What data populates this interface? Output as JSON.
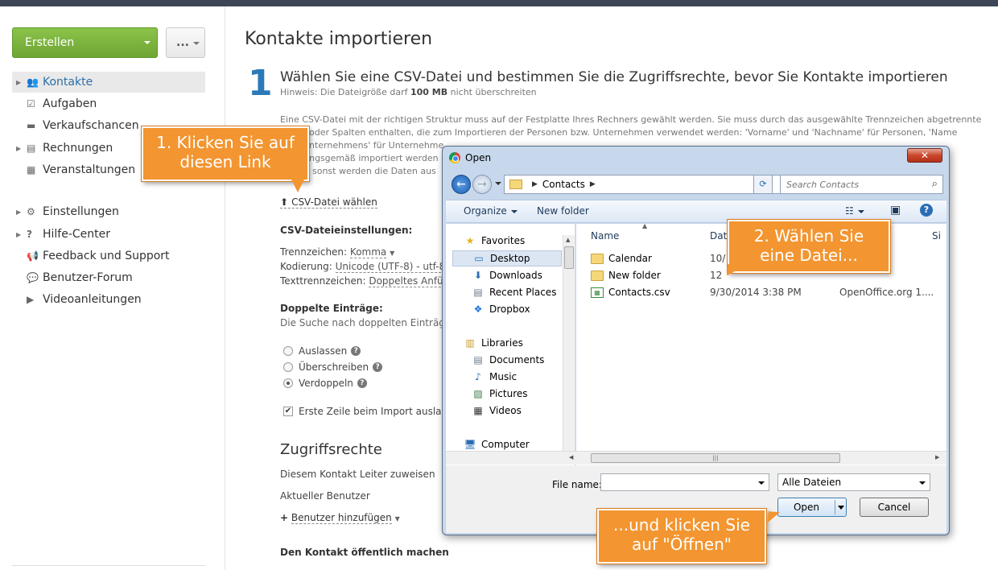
{
  "sidebar": {
    "create_label": "Erstellen",
    "more_label": "...",
    "items": [
      {
        "label": "Kontakte",
        "icon": "contacts-icon"
      },
      {
        "label": "Aufgaben",
        "icon": "tasks-icon"
      },
      {
        "label": "Verkaufschancen",
        "icon": "opportunities-icon"
      },
      {
        "label": "Rechnungen",
        "icon": "invoices-icon"
      },
      {
        "label": "Veranstaltungen",
        "icon": "events-icon"
      },
      {
        "label": "Einstellungen",
        "icon": "gear-icon"
      },
      {
        "label": "Hilfe-Center",
        "icon": "question-icon"
      },
      {
        "label": "Feedback und Support",
        "icon": "megaphone-icon"
      },
      {
        "label": "Benutzer-Forum",
        "icon": "speech-bubble-icon"
      },
      {
        "label": "Videoanleitungen",
        "icon": "video-icon"
      }
    ]
  },
  "main": {
    "title": "Kontakte importieren",
    "step_number": "1",
    "step_title": "Wählen Sie eine CSV-Datei und bestimmen Sie die Zugriffsrechte, bevor Sie Kontakte importieren",
    "hint_prefix": "Hinweis: Die Dateigröße darf",
    "hint_size": "100 MB",
    "hint_suffix": "nicht überschreiten",
    "desc_line1": "Eine CSV-Datei mit der richtigen Struktur muss auf der Festplatte Ihres Rechners gewählt werden. Sie muss durch das ausgewählte Trennzeichen abgetrennte",
    "desc_line2": "oder Spalten enthalten, die zum Importieren der Personen bzw. Unternehmen verwendet werden: 'Vorname' und 'Nachname' für Personen, 'Name",
    "desc_line3": "nternehmens' für Unternehme",
    "desc_line4": "ngsgemäß importiert werden",
    "desc_line5": "sonst werden die Daten aus",
    "csv_link": "CSV-Datei wählen",
    "csv_settings_head": "CSV-Dateieinstellungen:",
    "separator_label": "Trennzeichen:",
    "separator_value": "Komma",
    "encoding_label": "Kodierung:",
    "encoding_value": "Unicode (UTF-8) - utf-8",
    "text_sep_label": "Texttrennzeichen:",
    "text_sep_value": "Doppeltes Anfüh",
    "dup_head": "Doppelte Einträge:",
    "dup_note": "Die Suche nach doppelten Einträgen",
    "radio_skip": "Auslassen",
    "radio_overwrite": "Überschreiben",
    "radio_duplicate": "Verdoppeln",
    "skip_first_row": "Erste Zeile beim Import auslasse",
    "access_title": "Zugriffsrechte",
    "assign_leader": "Diesem Kontakt Leiter zuweisen",
    "current_user": "Aktueller Benutzer",
    "add_user": "Benutzer hinzufügen",
    "make_public": "Den Kontakt öffentlich machen"
  },
  "callouts": {
    "one_line1": "1. Klicken Sie auf",
    "one_line2": "diesen Link",
    "two_line1": "2. Wählen Sie",
    "two_line2": "eine Datei...",
    "three_line1": "...und klicken Sie",
    "three_line2": "auf \"Öffnen\""
  },
  "dialog": {
    "title": "Open",
    "close": "✕",
    "path": "Contacts",
    "search_placeholder": "Search Contacts",
    "organize": "Organize",
    "new_folder": "New folder",
    "tree": [
      {
        "label": "Favorites",
        "icon": "star-icon"
      },
      {
        "label": "Desktop",
        "icon": "desktop-icon"
      },
      {
        "label": "Downloads",
        "icon": "downloads-icon"
      },
      {
        "label": "Recent Places",
        "icon": "recent-places-icon"
      },
      {
        "label": "Dropbox",
        "icon": "dropbox-icon"
      },
      {
        "label": "Libraries",
        "icon": "libraries-icon"
      },
      {
        "label": "Documents",
        "icon": "documents-icon"
      },
      {
        "label": "Music",
        "icon": "music-icon"
      },
      {
        "label": "Pictures",
        "icon": "pictures-icon"
      },
      {
        "label": "Videos",
        "icon": "videos-icon"
      },
      {
        "label": "Computer",
        "icon": "computer-icon"
      }
    ],
    "col_name": "Name",
    "col_date": "Dat",
    "col_size": "Si",
    "files": [
      {
        "name": "Calendar",
        "date": "10/",
        "type": ""
      },
      {
        "name": "New folder",
        "date": "12",
        "type": ""
      },
      {
        "name": "Contacts.csv",
        "date": "9/30/2014 3:38 PM",
        "type": "OpenOffice.org 1...."
      }
    ],
    "file_name_label": "File name:",
    "file_name_value": "",
    "filter": "Alle Dateien",
    "open": "Open",
    "cancel": "Cancel"
  }
}
